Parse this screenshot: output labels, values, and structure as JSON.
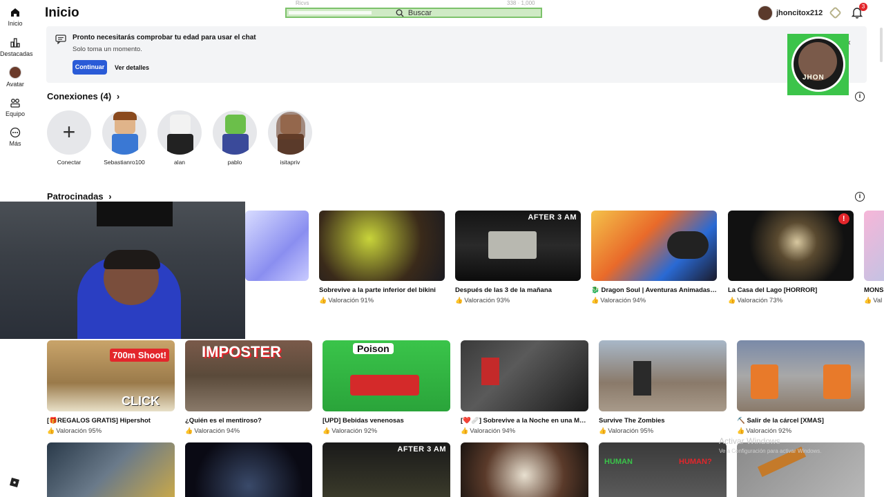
{
  "nav": {
    "items": [
      {
        "label": "Inicio",
        "icon": "home-icon"
      },
      {
        "label": "Destacadas",
        "icon": "chart-icon"
      },
      {
        "label": "Avatar",
        "icon": "avatar-icon"
      },
      {
        "label": "Equipo",
        "icon": "team-icon"
      },
      {
        "label": "Más",
        "icon": "more-icon"
      }
    ]
  },
  "header": {
    "title": "Inicio",
    "search_label": "Buscar",
    "username": "jhoncitox212",
    "notification_count": "3",
    "faint_left": "Ricvs",
    "faint_right": "338 · 1,000"
  },
  "banner": {
    "title": "Pronto necesitarás comprobar tu edad para usar el chat",
    "subtitle": "Solo toma un momento.",
    "continue_label": "Continuar",
    "details_label": "Ver detalles",
    "close": "×"
  },
  "overlay_logo": {
    "text": "JHON"
  },
  "connections": {
    "title": "Conexiones (4)",
    "connect_label": "Conectar",
    "people": [
      {
        "name": "Sebastianro100"
      },
      {
        "name": "alan"
      },
      {
        "name": "pablo"
      },
      {
        "name": "isitapriv"
      }
    ]
  },
  "sponsored": {
    "title": "Patrocinadas",
    "games": [
      {
        "title": "Sobrevive a la parte inferior del bikini",
        "rating": "Valoración 91%"
      },
      {
        "title": "Después de las 3 de la mañana",
        "rating": "Valoración 93%",
        "badge": "AFTER 3 AM"
      },
      {
        "title": "🐉 Dragon Soul | Aventuras Animadas ...",
        "rating": "Valoración 94%"
      },
      {
        "title": "La Casa del Lago [HORROR]",
        "rating": "Valoración 73%",
        "badge": "!"
      },
      {
        "title": "MONS",
        "rating": "Val"
      }
    ]
  },
  "games_row2": [
    {
      "title": "[🎁REGALOS GRATIS] Hipershot",
      "rating": "Valoración 95%",
      "overlay": "700m Shoot!",
      "overlay2": "CLICK"
    },
    {
      "title": "¿Quién es el mentiroso?",
      "rating": "Valoración 94%",
      "overlay": "IMPOSTER"
    },
    {
      "title": "[UPD] Bebidas venenosas",
      "rating": "Valoración 92%",
      "overlay": "Poison"
    },
    {
      "title": "[❤️🩹] Sobrevive a la Noche en una Me...",
      "rating": "Valoración 94%"
    },
    {
      "title": "Survive The Zombies",
      "rating": "Valoración 95%"
    },
    {
      "title": "⛏️ Salir de la cárcel [XMAS]",
      "rating": "Valoración 92%"
    }
  ],
  "games_row3": [
    {
      "badge": ""
    },
    {
      "badge": ""
    },
    {
      "badge": "AFTER 3 AM"
    },
    {
      "badge": ""
    },
    {
      "badge": "HUMAN",
      "badge2": "HUMAN?"
    },
    {
      "badge": ""
    }
  ],
  "watermark": {
    "line1": "Activar Windows",
    "line2": "Ve a Configuración para activar Windows."
  },
  "colors": {
    "accent_blue": "#2a5bd7",
    "search_green": "#7cc26a",
    "badge_red": "#e3262b"
  }
}
